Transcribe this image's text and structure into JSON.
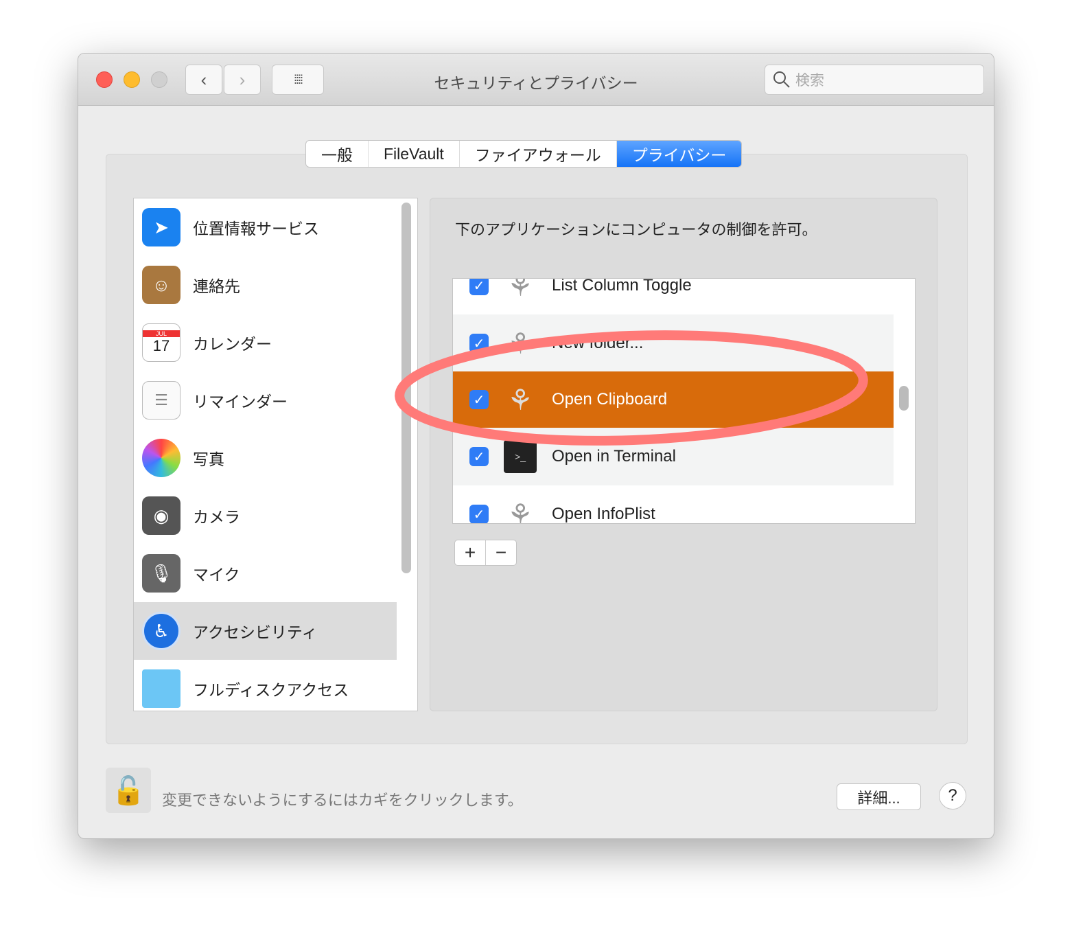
{
  "window": {
    "title": "セキュリティとプライバシー",
    "search_placeholder": "検索"
  },
  "tabs": [
    {
      "label": "一般"
    },
    {
      "label": "FileVault"
    },
    {
      "label": "ファイアウォール"
    },
    {
      "label": "プライバシー",
      "selected": true
    }
  ],
  "sidebar": {
    "items": [
      {
        "label": "位置情報サービス",
        "icon": "location-arrow-icon"
      },
      {
        "label": "連絡先",
        "icon": "contacts-icon"
      },
      {
        "label": "カレンダー",
        "icon": "calendar-icon",
        "icon_month": "JUL",
        "icon_day": "17"
      },
      {
        "label": "リマインダー",
        "icon": "reminders-icon"
      },
      {
        "label": "写真",
        "icon": "photos-icon"
      },
      {
        "label": "カメラ",
        "icon": "camera-icon"
      },
      {
        "label": "マイク",
        "icon": "microphone-icon"
      },
      {
        "label": "アクセシビリティ",
        "icon": "accessibility-icon",
        "selected": true
      },
      {
        "label": "フルディスクアクセス",
        "icon": "folder-icon"
      }
    ]
  },
  "main": {
    "description": "下のアプリケーションにコンピュータの制御を許可。",
    "apps": [
      {
        "name": "List Column Toggle",
        "checked": true
      },
      {
        "name": "New folder...",
        "checked": true
      },
      {
        "name": "Open Clipboard",
        "checked": true,
        "selected": true
      },
      {
        "name": "Open in Terminal",
        "checked": true
      },
      {
        "name": "Open InfoPlist",
        "checked": true
      }
    ],
    "add_label": "+",
    "remove_label": "−"
  },
  "footer": {
    "lock_text": "変更できないようにするにはカギをクリックします。",
    "details_label": "詳細...",
    "help_label": "?"
  },
  "colors": {
    "selection": "#d86b0b",
    "accent": "#1674f7",
    "annotation": "#ff7a78"
  }
}
